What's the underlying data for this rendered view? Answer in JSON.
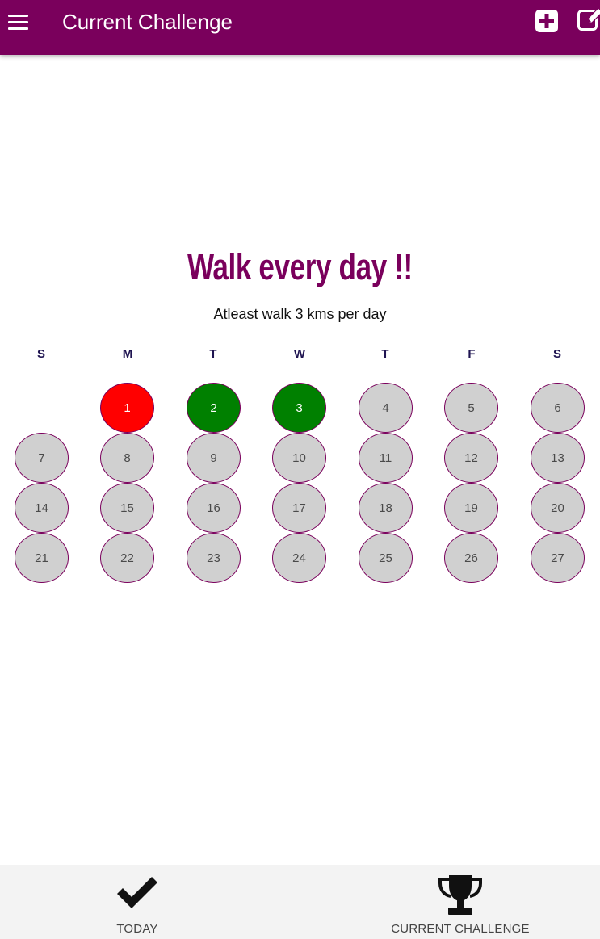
{
  "appbar": {
    "title": "Current Challenge",
    "background": "#7a005c",
    "menu_icon": "hamburger-menu-icon",
    "add_icon": "plus-square-icon",
    "edit_icon": "edit-square-icon"
  },
  "challenge": {
    "title": "Walk every day !!",
    "subtitle": "Atleast walk 3 kms per day",
    "title_color": "#7a005c"
  },
  "calendar": {
    "weekdays": [
      "S",
      "M",
      "T",
      "W",
      "T",
      "F",
      "S"
    ],
    "days": [
      {
        "label": "1",
        "status": "missed"
      },
      {
        "label": "2",
        "status": "done"
      },
      {
        "label": "3",
        "status": "done"
      },
      {
        "label": "4",
        "status": "pending"
      },
      {
        "label": "5",
        "status": "pending"
      },
      {
        "label": "6",
        "status": "pending"
      },
      {
        "label": "7",
        "status": "pending"
      },
      {
        "label": "8",
        "status": "pending"
      },
      {
        "label": "9",
        "status": "pending"
      },
      {
        "label": "10",
        "status": "pending"
      },
      {
        "label": "11",
        "status": "pending"
      },
      {
        "label": "12",
        "status": "pending"
      },
      {
        "label": "13",
        "status": "pending"
      },
      {
        "label": "14",
        "status": "pending"
      },
      {
        "label": "15",
        "status": "pending"
      },
      {
        "label": "16",
        "status": "pending"
      },
      {
        "label": "17",
        "status": "pending"
      },
      {
        "label": "18",
        "status": "pending"
      },
      {
        "label": "19",
        "status": "pending"
      },
      {
        "label": "20",
        "status": "pending"
      },
      {
        "label": "21",
        "status": "pending"
      },
      {
        "label": "22",
        "status": "pending"
      },
      {
        "label": "23",
        "status": "pending"
      },
      {
        "label": "24",
        "status": "pending"
      },
      {
        "label": "25",
        "status": "pending"
      },
      {
        "label": "26",
        "status": "pending"
      },
      {
        "label": "27",
        "status": "pending"
      }
    ],
    "status_colors": {
      "missed": "#ff0000",
      "done": "#008000",
      "pending": "#d0d0d0"
    }
  },
  "bottom_nav": {
    "items": [
      {
        "label": "TODAY",
        "icon": "checkmark-icon"
      },
      {
        "label": "CURRENT CHALLENGE",
        "icon": "trophy-icon"
      }
    ]
  }
}
